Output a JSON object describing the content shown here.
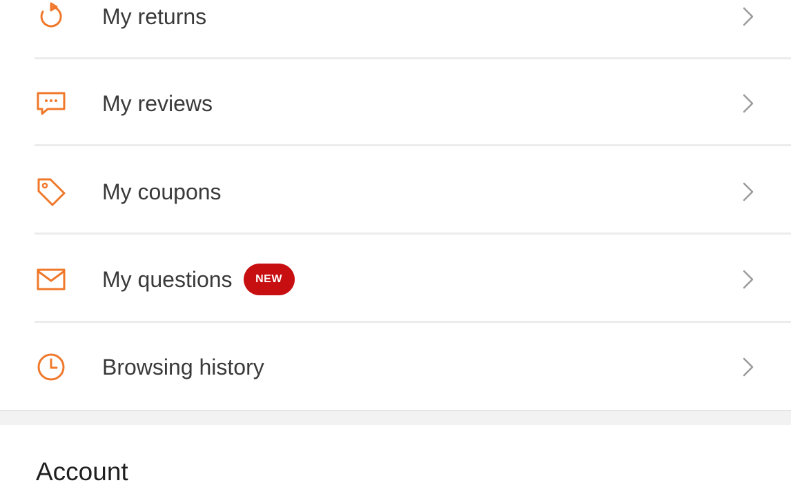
{
  "menu": {
    "items": [
      {
        "label": "My returns",
        "icon": "refresh-icon"
      },
      {
        "label": "My reviews",
        "icon": "chat-bubble-icon"
      },
      {
        "label": "My coupons",
        "icon": "tag-icon"
      },
      {
        "label": "My questions",
        "icon": "envelope-icon",
        "badge": "NEW"
      },
      {
        "label": "Browsing history",
        "icon": "clock-icon"
      }
    ]
  },
  "account": {
    "title": "Account"
  },
  "colors": {
    "accent": "#f0782a",
    "badge": "#c70e10",
    "text": "#3a3a3a",
    "chevron": "#9a9a9a"
  }
}
